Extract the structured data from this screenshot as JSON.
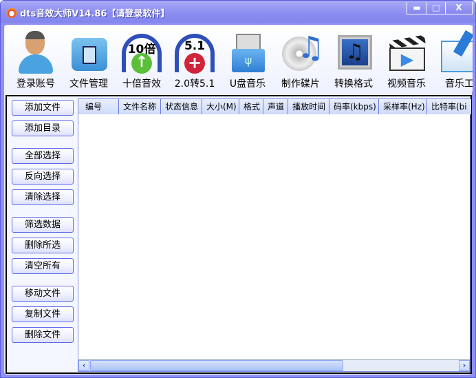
{
  "window": {
    "title": "dts音效大师V14.86【请登录软件】",
    "minimize": "▬",
    "maximize": "□",
    "close": "X"
  },
  "toolbar": [
    {
      "label": "登录账号",
      "icon": "user-icon"
    },
    {
      "label": "文件管理",
      "icon": "folder-icon"
    },
    {
      "label": "十倍音效",
      "icon": "headphones-10x-icon",
      "badge": "10倍"
    },
    {
      "label": "2.0转5.1",
      "icon": "headphones-51-icon",
      "badge": "5.1"
    },
    {
      "label": "U盘音乐",
      "icon": "usb-icon"
    },
    {
      "label": "制作碟片",
      "icon": "cd-music-icon"
    },
    {
      "label": "转换格式",
      "icon": "music-note-icon"
    },
    {
      "label": "视频音乐",
      "icon": "clapper-icon"
    },
    {
      "label": "音乐工",
      "icon": "tools-icon"
    }
  ],
  "side_buttons": [
    "添加文件",
    "添加目录",
    "全部选择",
    "反向选择",
    "清除选择",
    "筛选数据",
    "删除所选",
    "清空所有",
    "移动文件",
    "复制文件",
    "删除文件"
  ],
  "columns": [
    "编号",
    "文件名称",
    "状态信息",
    "大小(M)",
    "格式",
    "声道",
    "播放时间",
    "码率(kbps)",
    "采样率(Hz)",
    "比特率(bi"
  ],
  "scroll": {
    "left": "‹",
    "right": "›"
  }
}
